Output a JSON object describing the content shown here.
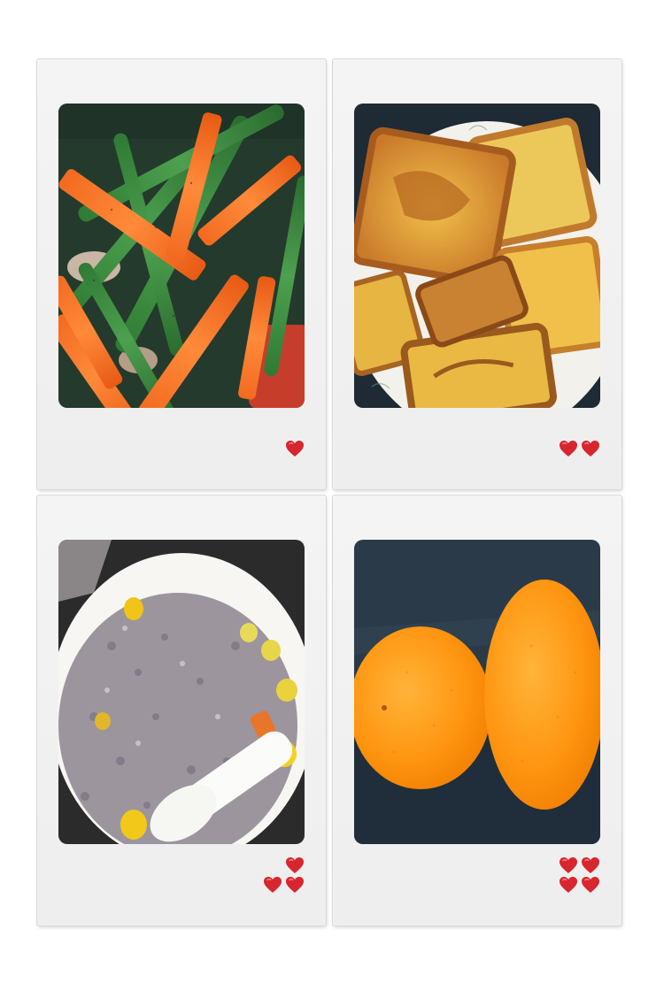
{
  "collage": {
    "photos": [
      {
        "subject": "vegetables-icon",
        "hearts": [
          1
        ]
      },
      {
        "subject": "toast-icon",
        "hearts": [
          2
        ]
      },
      {
        "subject": "porridge-icon",
        "hearts": [
          1,
          2
        ]
      },
      {
        "subject": "oranges-icon",
        "hearts": [
          2,
          2
        ]
      }
    ],
    "colors": {
      "frame": "#eeeeee",
      "heart": "#d8262f",
      "page": "#ffffff"
    }
  }
}
